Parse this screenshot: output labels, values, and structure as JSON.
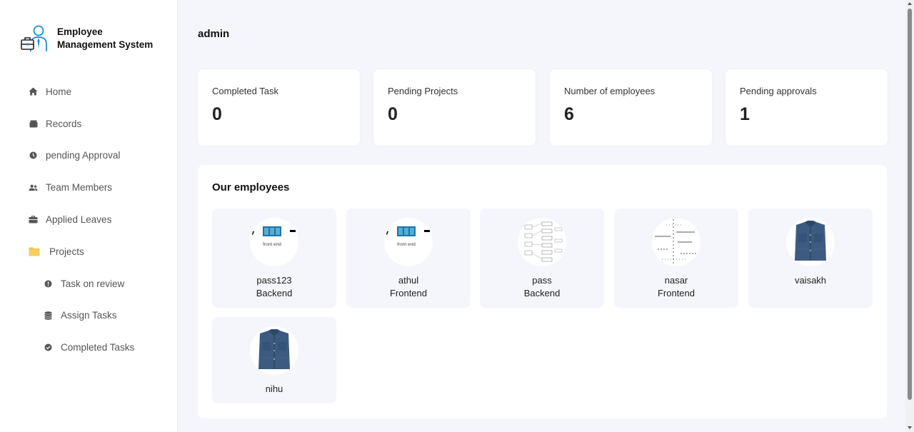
{
  "brand": {
    "line1": "Employee",
    "line2": "Management System"
  },
  "sidebar": {
    "items": [
      {
        "label": "Home",
        "icon": "home-icon"
      },
      {
        "label": "Records",
        "icon": "folder-box-icon"
      },
      {
        "label": "pending Approval",
        "icon": "clock-icon"
      },
      {
        "label": "Team Members",
        "icon": "users-icon"
      },
      {
        "label": "Applied Leaves",
        "icon": "briefcase-icon"
      },
      {
        "label": "Projects",
        "icon": "folder-icon"
      },
      {
        "label": "Task on review",
        "icon": "alert-circle-icon"
      },
      {
        "label": "Assign Tasks",
        "icon": "database-icon"
      },
      {
        "label": "Completed Tasks",
        "icon": "check-circle-icon"
      }
    ]
  },
  "header": {
    "user": "admin"
  },
  "stats": [
    {
      "label": "Completed Task",
      "value": "0"
    },
    {
      "label": "Pending Projects",
      "value": "0"
    },
    {
      "label": "Number of employees",
      "value": "6"
    },
    {
      "label": "Pending approvals",
      "value": "1"
    }
  ],
  "employees": {
    "title": "Our employees",
    "list": [
      {
        "name": "pass123",
        "role": "Backend",
        "avatar": "frontend-logo-image"
      },
      {
        "name": "athul",
        "role": "Frontend",
        "avatar": "frontend-logo-image"
      },
      {
        "name": "pass",
        "role": "Backend",
        "avatar": "diagram-image"
      },
      {
        "name": "nasar",
        "role": "Frontend",
        "avatar": "sketch-diagram-image"
      },
      {
        "name": "vaisakh",
        "role": "",
        "avatar": "denim-shirt-image"
      },
      {
        "name": "nihu",
        "role": "",
        "avatar": "denim-shirt-image"
      }
    ],
    "avatar_caption": "front end"
  },
  "colors": {
    "accent_blue": "#1a8fd0",
    "folder_yellow": "#f6c342",
    "page_bg": "#f5f6fb"
  }
}
